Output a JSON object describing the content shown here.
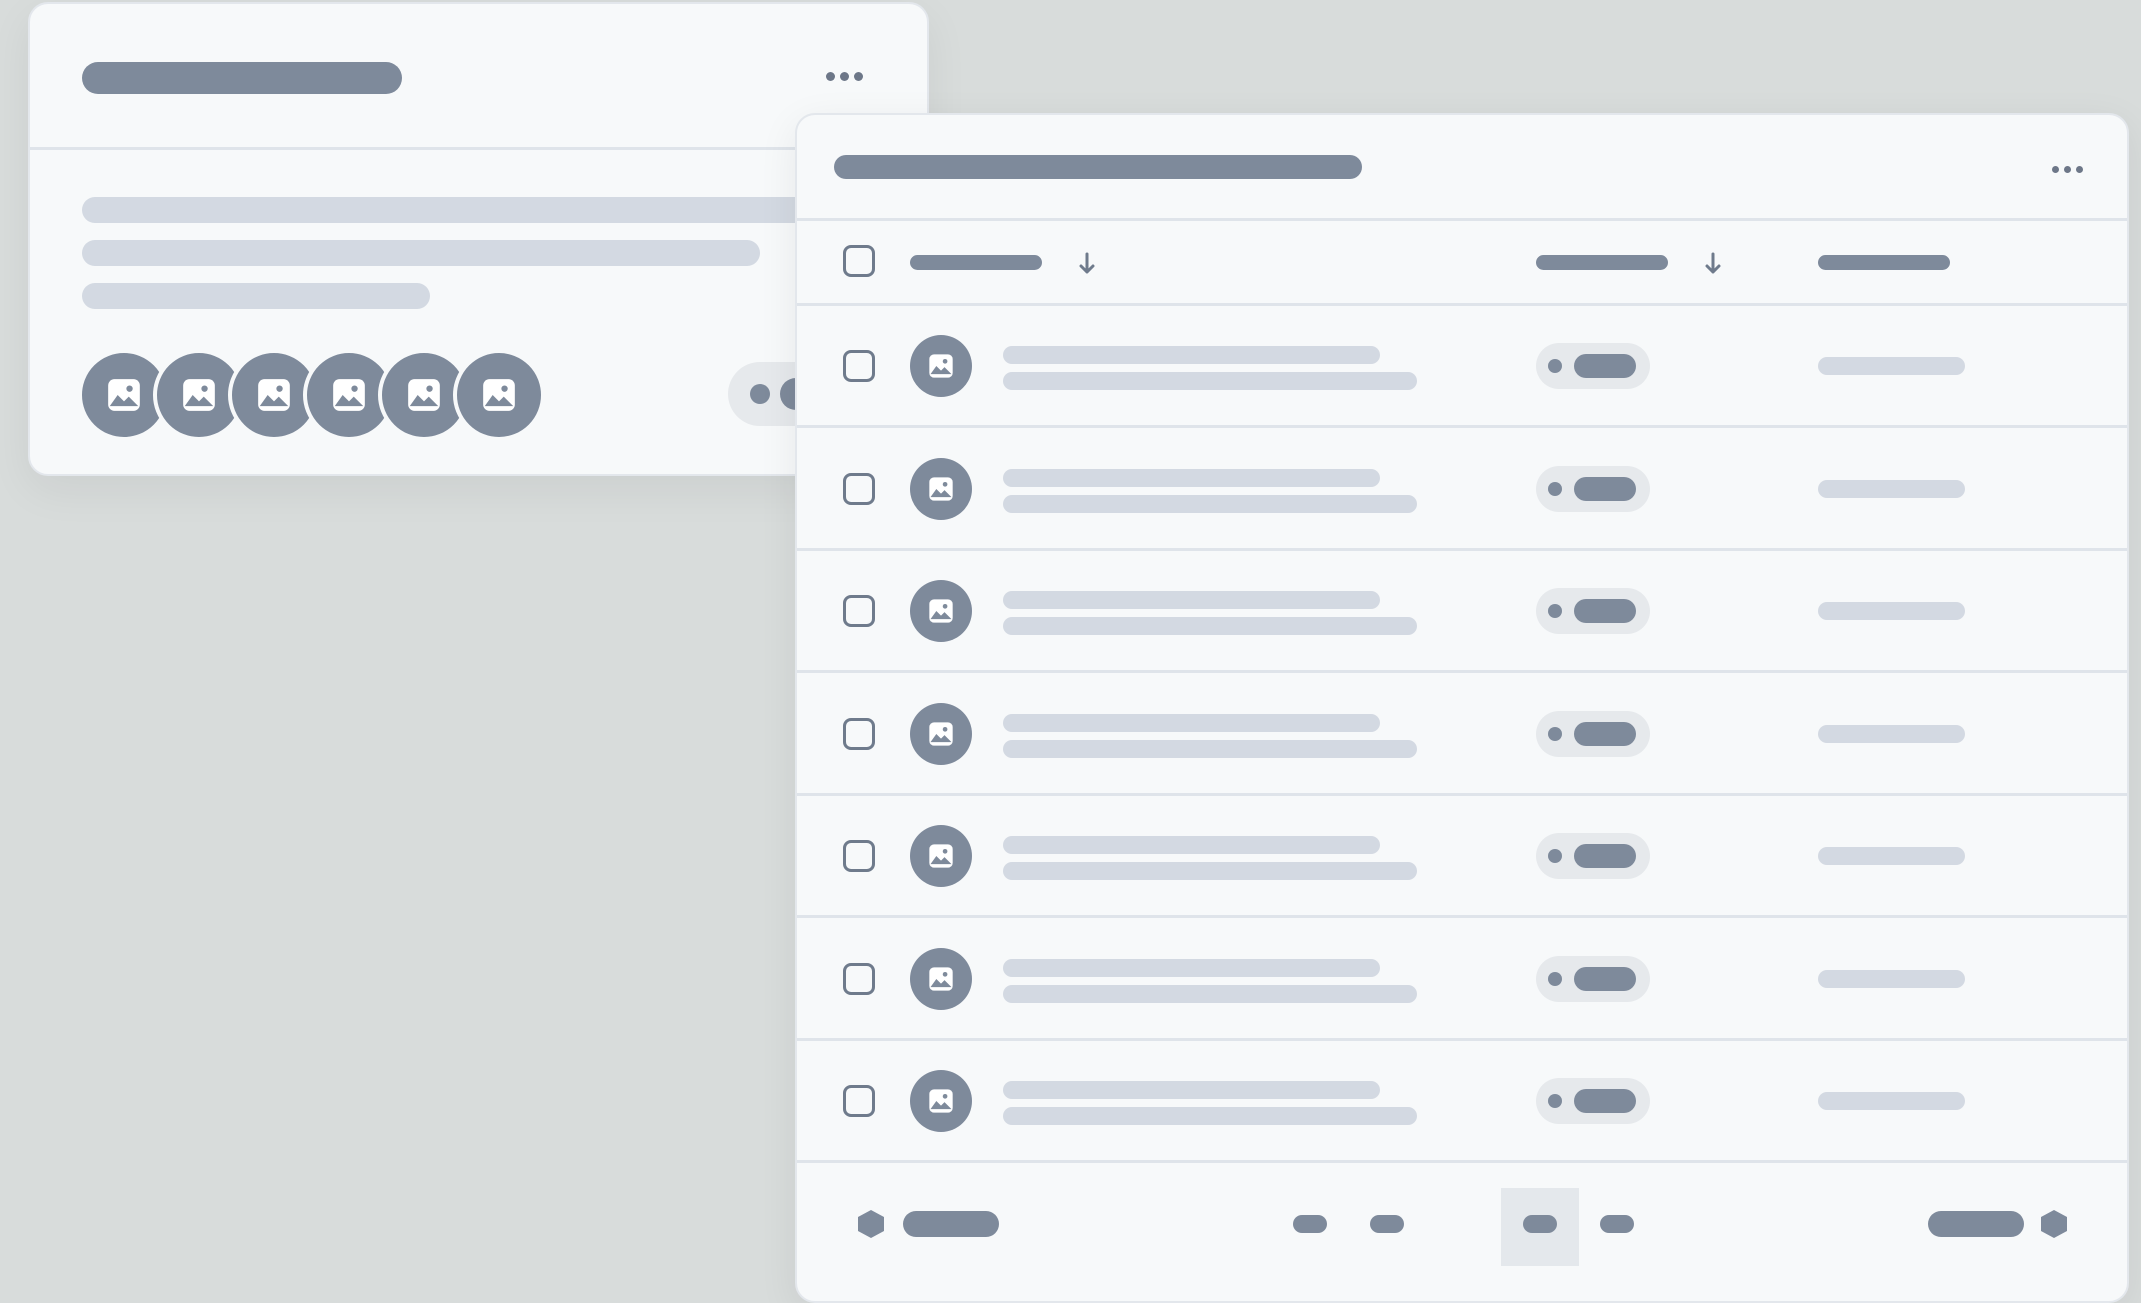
{
  "colors": {
    "background": "#d8dcdb",
    "card": "#f7f9fa",
    "skeleton_dark": "#7e8a9b",
    "skeleton_light": "#d3d9e2",
    "pill_bg": "#e6e9ec",
    "active_page_bg": "#e4e8ec"
  },
  "icons": {
    "menu": "more-horizontal-icon",
    "avatar": "image-placeholder-icon",
    "sort": "arrow-down-icon",
    "pagination_prev": "hexagon-prev-icon",
    "pagination_next": "hexagon-next-icon",
    "checkbox": "checkbox-unchecked-icon"
  },
  "card_a": {
    "avatar_stack_count": 6
  },
  "table": {
    "row_count": 7,
    "sortable_columns": 2,
    "pagination": {
      "page_count": 4,
      "active_page": 3
    }
  }
}
